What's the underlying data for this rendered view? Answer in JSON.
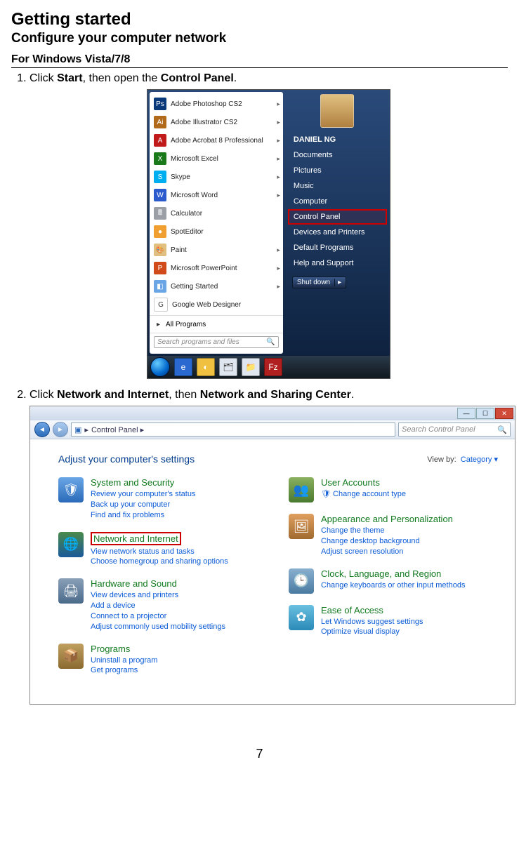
{
  "doc": {
    "h1": "Getting started",
    "h2": "Configure your computer network",
    "h3": "For Windows Vista/7/8",
    "step1_pre": "Click ",
    "step1_b1": "Start",
    "step1_mid": ", then open the ",
    "step1_b2": "Control Panel",
    "step1_post": ".",
    "step2_pre": "Click ",
    "step2_b1": "Network and Internet",
    "step2_mid": ", then ",
    "step2_b2": "Network and Sharing Center",
    "step2_post": ".",
    "pagenum": "7"
  },
  "startmenu": {
    "left": [
      {
        "label": "Adobe Photoshop CS2",
        "iconBg": "#0a3a7a",
        "iconTxt": "Ps",
        "arrow": true
      },
      {
        "label": "Adobe Illustrator CS2",
        "iconBg": "#b06a1a",
        "iconTxt": "Ai",
        "arrow": true
      },
      {
        "label": "Adobe Acrobat 8 Professional",
        "iconBg": "#c01a1a",
        "iconTxt": "A",
        "arrow": true
      },
      {
        "label": "Microsoft Excel",
        "iconBg": "#1a7a1a",
        "iconTxt": "X",
        "arrow": true
      },
      {
        "label": "Skype",
        "iconBg": "#00aff0",
        "iconTxt": "S",
        "arrow": true
      },
      {
        "label": "Microsoft Word",
        "iconBg": "#2a5acc",
        "iconTxt": "W",
        "arrow": true
      },
      {
        "label": "Calculator",
        "iconBg": "#9aa0a6",
        "iconTxt": "🖩",
        "arrow": false
      },
      {
        "label": "SpotEditor",
        "iconBg": "#f0a030",
        "iconTxt": "●",
        "arrow": false
      },
      {
        "label": "Paint",
        "iconBg": "#e0c080",
        "iconTxt": "🎨",
        "arrow": true
      },
      {
        "label": "Microsoft PowerPoint",
        "iconBg": "#d04a1a",
        "iconTxt": "P",
        "arrow": true
      },
      {
        "label": "Getting Started",
        "iconBg": "#6aa6e6",
        "iconTxt": "◧",
        "arrow": true
      },
      {
        "label": "Google Web Designer",
        "iconBg": "#ffffff",
        "iconTxt": "G",
        "arrow": false
      }
    ],
    "allprograms": "All Programs",
    "search_placeholder": "Search programs and files",
    "right_user": "DANIEL NG",
    "right": [
      {
        "label": "Documents"
      },
      {
        "label": "Pictures"
      },
      {
        "label": "Music"
      },
      {
        "label": "Computer"
      },
      {
        "label": "Control Panel",
        "hl": true
      },
      {
        "label": "Devices and Printers"
      },
      {
        "label": "Default Programs"
      },
      {
        "label": "Help and Support"
      }
    ],
    "shutdown": "Shut down"
  },
  "taskbar": {
    "icons": [
      {
        "bg": "#2a6ad0",
        "txt": "e"
      },
      {
        "bg": "#f0c040",
        "txt": "◐"
      },
      {
        "bg": "#e0e6f0",
        "txt": "🗂"
      },
      {
        "bg": "#e0e6f0",
        "txt": "📁"
      },
      {
        "bg": "#b02020",
        "txt": "Fz"
      }
    ]
  },
  "cp": {
    "breadcrumb": "Control Panel  ▸",
    "search_placeholder": "Search Control Panel",
    "header": "Adjust your computer's settings",
    "viewby_label": "View by:",
    "viewby_value": "Category ▾",
    "left": [
      {
        "title": "System and Security",
        "iconBg": "linear-gradient(#6aa6e6,#2a6ab8)",
        "glyph": "🛡",
        "links": [
          "Review your computer's status",
          "Back up your computer",
          "Find and fix problems"
        ]
      },
      {
        "title": "Network and Internet",
        "hl": true,
        "iconBg": "linear-gradient(#4a8a4a,#1a5a9a)",
        "glyph": "🌐",
        "links": [
          "View network status and tasks",
          "Choose homegroup and sharing options"
        ]
      },
      {
        "title": "Hardware and Sound",
        "iconBg": "linear-gradient(#8aa0b8,#4a6a8a)",
        "glyph": "🖨",
        "links": [
          "View devices and printers",
          "Add a device",
          "Connect to a projector",
          "Adjust commonly used mobility settings"
        ]
      },
      {
        "title": "Programs",
        "iconBg": "linear-gradient(#c0a060,#8a6a30)",
        "glyph": "📦",
        "links": [
          "Uninstall a program",
          "Get programs"
        ]
      }
    ],
    "right": [
      {
        "title": "User Accounts",
        "iconBg": "linear-gradient(#8ab060,#4a7a30)",
        "glyph": "👥",
        "links": [
          "🛡 Change account type"
        ]
      },
      {
        "title": "Appearance and Personalization",
        "iconBg": "linear-gradient(#e0a060,#a06a30)",
        "glyph": "🖼",
        "links": [
          "Change the theme",
          "Change desktop background",
          "Adjust screen resolution"
        ]
      },
      {
        "title": "Clock, Language, and Region",
        "iconBg": "linear-gradient(#8ab0d0,#4a7aa0)",
        "glyph": "🕒",
        "links": [
          "Change keyboards or other input methods"
        ]
      },
      {
        "title": "Ease of Access",
        "iconBg": "linear-gradient(#6ac0e0,#2a8ab8)",
        "glyph": "✿",
        "links": [
          "Let Windows suggest settings",
          "Optimize visual display"
        ]
      }
    ]
  }
}
